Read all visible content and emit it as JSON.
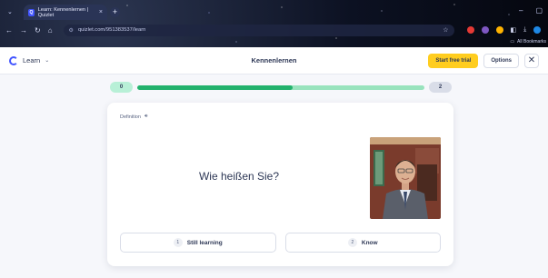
{
  "browser": {
    "tab_title": "Learn: Kennenlernen | Quizlet",
    "url": "quizlet.com/951383537/learn",
    "bookmarks_label": "All Bookmarks"
  },
  "header": {
    "mode_label": "Learn",
    "set_title": "Kennenlernen",
    "trial_button": "Start free trial",
    "options_button": "Options"
  },
  "progress": {
    "left_count": "0",
    "right_count": "2",
    "completed_fraction": 0.54
  },
  "card": {
    "section_label": "Definition",
    "term": "Wie heißen Sie?",
    "answers": [
      {
        "number": "1",
        "label": "Still learning"
      },
      {
        "number": "2",
        "label": "Know"
      }
    ]
  },
  "colors": {
    "brand": "#4255ff",
    "trial": "#ffcd1f",
    "progress_fill": "#23b26d",
    "progress_track": "#98e3bd"
  },
  "icons": [
    "spinner-icon",
    "chevron-down-icon",
    "close-icon",
    "audio-icon",
    "star-icon",
    "tune-icon"
  ]
}
